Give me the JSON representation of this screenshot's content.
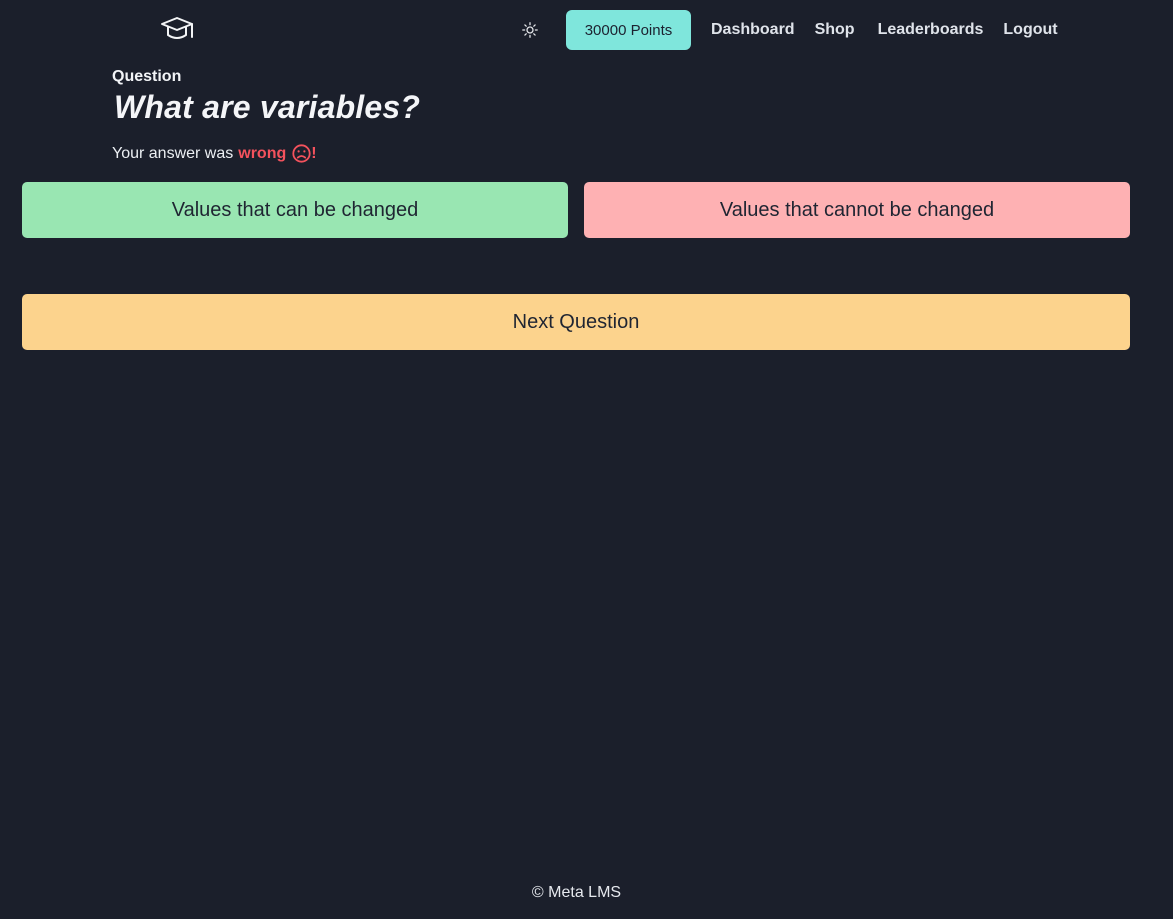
{
  "nav": {
    "points_label": "30000 Points",
    "links": [
      "Dashboard",
      "Shop",
      "Leaderboards",
      "Logout"
    ],
    "logo_icon": "graduation-cap-icon",
    "theme_icon": "sun-icon"
  },
  "question": {
    "label": "Question",
    "title": "What are variables?"
  },
  "result": {
    "prefix": "Your answer was",
    "word": "wrong",
    "suffix": "!",
    "icon": "sad-face-icon"
  },
  "answers": [
    {
      "text": "Values that can be changed",
      "state": "correct"
    },
    {
      "text": "Values that cannot be changed",
      "state": "wrong"
    }
  ],
  "next_button": "Next Question",
  "footer": "© Meta LMS",
  "colors": {
    "background": "#1b1f2b",
    "points": "#7fe6dc",
    "correct": "#99e6b2",
    "wrong": "#feb1b3",
    "next": "#fcd38d",
    "wrong_text": "#f4525d"
  }
}
